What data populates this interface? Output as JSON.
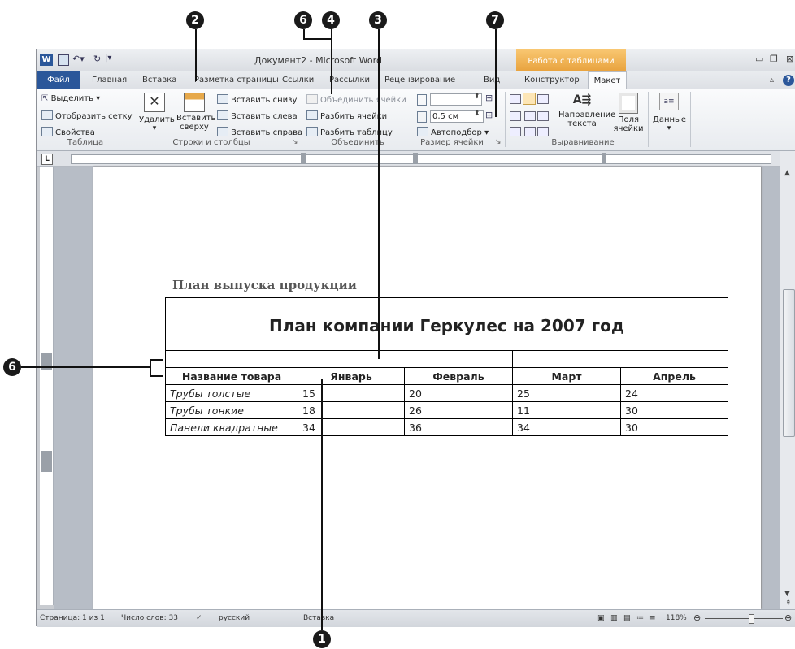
{
  "window": {
    "title": "Документ2 - Microsoft Word",
    "context_tab_group": "Работа с таблицами"
  },
  "tabs": [
    "Файл",
    "Главная",
    "Вставка",
    "Разметка страницы",
    "Ссылки",
    "Рассылки",
    "Рецензирование",
    "Вид",
    "Конструктор",
    "Макет"
  ],
  "ribbon": {
    "table_group": {
      "select": "Выделить",
      "gridlines": "Отобразить сетку",
      "properties": "Свойства",
      "label": "Таблица"
    },
    "rows_cols_group": {
      "delete": "Удалить",
      "insert_above": "Вставить сверху",
      "insert_below": "Вставить снизу",
      "insert_left": "Вставить слева",
      "insert_right": "Вставить справа",
      "label": "Строки и столбцы"
    },
    "merge_group": {
      "merge_cells": "Объединить ячейки",
      "split_cells": "Разбить ячейки",
      "split_table": "Разбить таблицу",
      "label": "Объединить"
    },
    "cell_size_group": {
      "width_value": "0,5 см",
      "autofit": "Автоподбор",
      "label": "Размер ячейки"
    },
    "alignment_group": {
      "text_direction": "Направление текста",
      "cell_margins": "Поля ячейки",
      "label": "Выравнивание"
    },
    "data_group": {
      "data": "Данные"
    }
  },
  "document": {
    "heading": "План выпуска продукции",
    "table_title": "План компании Геркулес на 2007 год",
    "columns": [
      "Название товара",
      "Январь",
      "Февраль",
      "Март",
      "Апрель"
    ],
    "rows": [
      [
        "Трубы толстые",
        "15",
        "20",
        "25",
        "24"
      ],
      [
        "Трубы тонкие",
        "18",
        "26",
        "11",
        "30"
      ],
      [
        "Панели квадратные",
        "34",
        "36",
        "34",
        "30"
      ]
    ]
  },
  "status": {
    "page": "Страница: 1 из 1",
    "words": "Число слов: 33",
    "language": "русский",
    "mode": "Вставка",
    "zoom": "118%"
  },
  "callouts": [
    "1",
    "2",
    "3",
    "4",
    "6",
    "6",
    "7"
  ],
  "colors": {
    "file_tab": "#2b579a",
    "context_tab": "#e8a23d"
  }
}
